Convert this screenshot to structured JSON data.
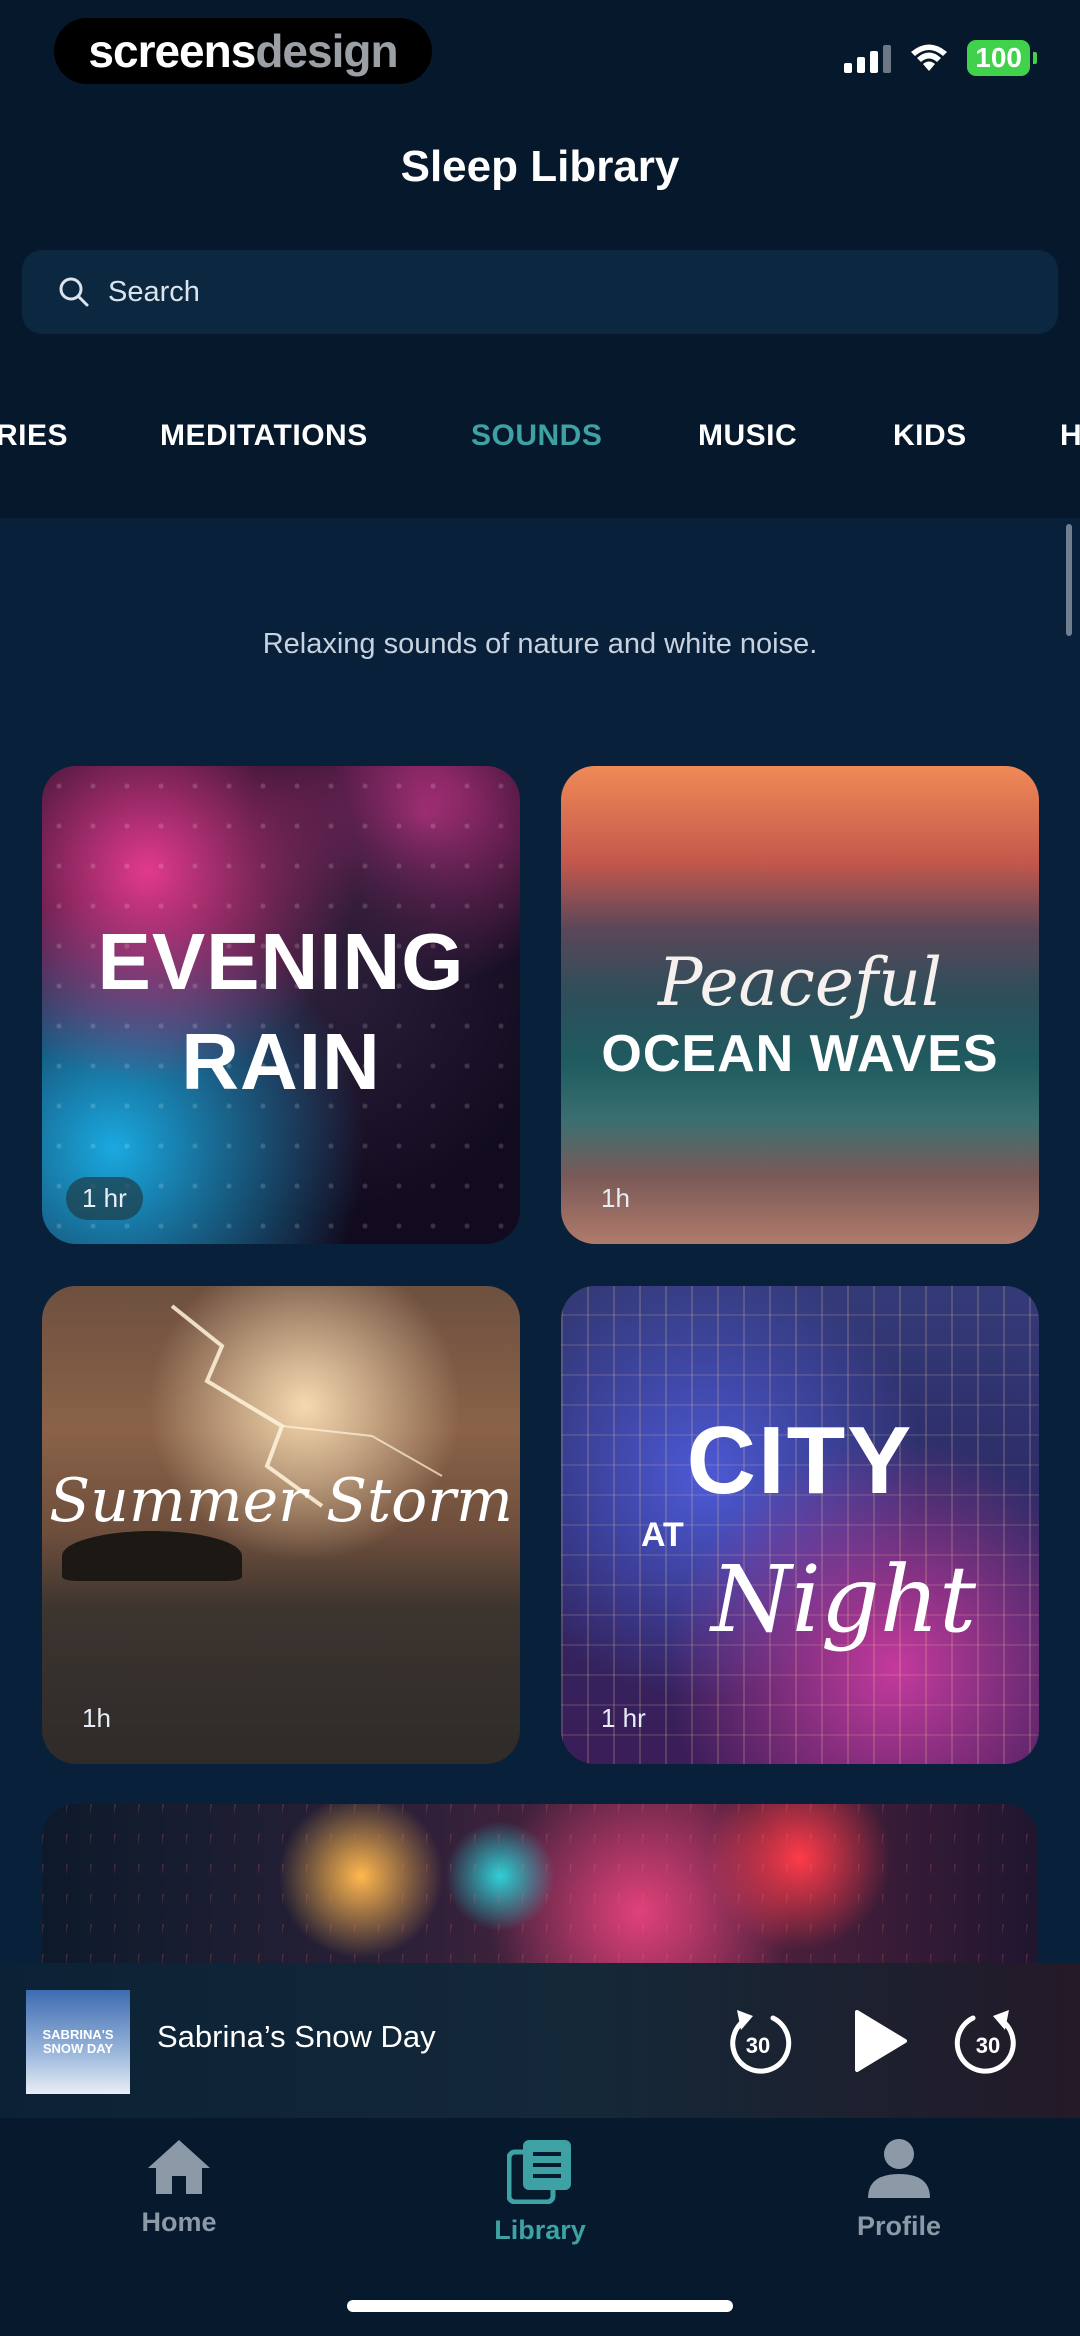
{
  "status_bar": {
    "logo_left": "screens",
    "logo_right": "design",
    "battery": "100"
  },
  "header": {
    "title": "Sleep Library"
  },
  "search": {
    "placeholder": "Search"
  },
  "tabs": [
    {
      "label": "RIES"
    },
    {
      "label": "MEDITATIONS"
    },
    {
      "label": "SOUNDS"
    },
    {
      "label": "MUSIC"
    },
    {
      "label": "KIDS"
    },
    {
      "label": "H"
    }
  ],
  "active_tab": "SOUNDS",
  "section": {
    "description": "Relaxing sounds of nature and white noise."
  },
  "cards": [
    {
      "title_line1": "EVENING",
      "title_line2": "RAIN",
      "duration": "1 hr"
    },
    {
      "title_line1": "Peaceful",
      "title_line2": "OCEAN WAVES",
      "duration": "1h"
    },
    {
      "title_line1": "Summer Storm",
      "duration": "1h"
    },
    {
      "title_line1": "CITY",
      "title_line2": "AT",
      "title_line3": "Night",
      "duration": "1 hr"
    }
  ],
  "player": {
    "art_text": "SABRINA'S SNOW DAY",
    "track_title": "Sabrina’s Snow Day",
    "skip_back_seconds": "30",
    "skip_forward_seconds": "30"
  },
  "tab_bar": {
    "items": [
      {
        "label": "Home",
        "icon": "home-icon"
      },
      {
        "label": "Library",
        "icon": "library-icon"
      },
      {
        "label": "Profile",
        "icon": "profile-icon"
      }
    ],
    "active": "Library"
  },
  "colors": {
    "accent": "#3ea1a4",
    "background": "#08203a",
    "battery": "#3fd24a"
  }
}
